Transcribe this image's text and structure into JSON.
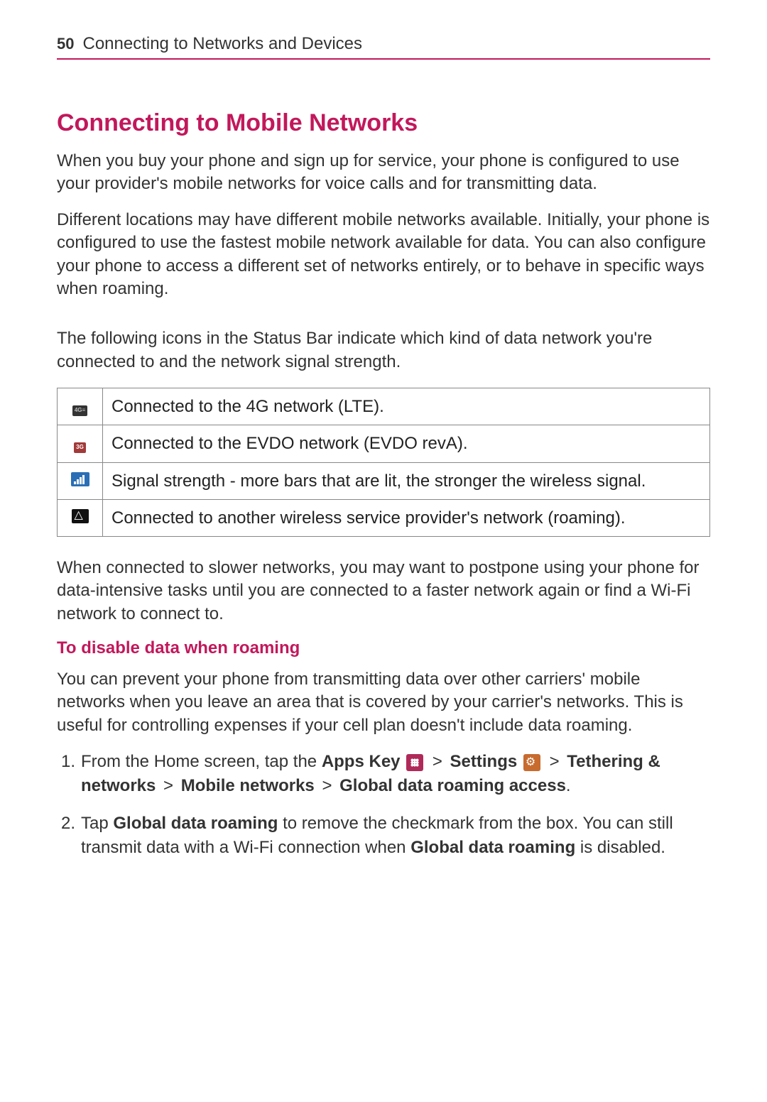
{
  "header": {
    "page_number": "50",
    "chapter_title": "Connecting to Networks and Devices"
  },
  "h1": "Connecting to Mobile Networks",
  "para1": "When you buy your phone and sign up for service, your phone is configured to use your provider's mobile networks for voice calls and for transmitting data.",
  "para2": "Different locations may have different mobile networks available. Initially, your phone is configured to use the fastest mobile network available for data. You can also configure your phone to access a different set of networks entirely, or to behave in specific ways when roaming.",
  "para3": "The following icons in the Status Bar indicate which kind of data network you're connected to and the network signal strength.",
  "table": {
    "rows": [
      {
        "icon": "4G",
        "desc": "Connected to the 4G network (LTE)."
      },
      {
        "icon": "3G",
        "desc": "Connected to the EVDO network (EVDO revA)."
      },
      {
        "icon": "signal",
        "desc": "Signal strength - more bars that are lit, the stronger the wireless signal."
      },
      {
        "icon": "roaming",
        "desc": "Connected to another wireless service provider's network (roaming)."
      }
    ]
  },
  "para4": "When connected to slower networks, you may want to postpone using your phone for data-intensive tasks until you are connected to a faster network again or find a Wi-Fi network to connect to.",
  "h2": "To disable data when roaming",
  "para5": "You can prevent your phone from transmitting data over other carriers' mobile networks when you leave an area that is covered by your carrier's networks. This is useful for controlling expenses if your cell plan doesn't include data roaming.",
  "steps": {
    "s1_prefix": "From the Home screen, tap the ",
    "s1_apps": "Apps Key",
    "s1_settings": "Settings",
    "s1_tether": "Tethering & networks",
    "s1_mobile": "Mobile networks",
    "s1_global": "Global data roaming access",
    "gt": ">",
    "period": ".",
    "s2_a": "Tap ",
    "s2_b": "Global data roaming",
    "s2_c": " to remove the checkmark from the box. You can still transmit data with a Wi-Fi connection when ",
    "s2_d": "Global data roaming",
    "s2_e": " is disabled."
  }
}
